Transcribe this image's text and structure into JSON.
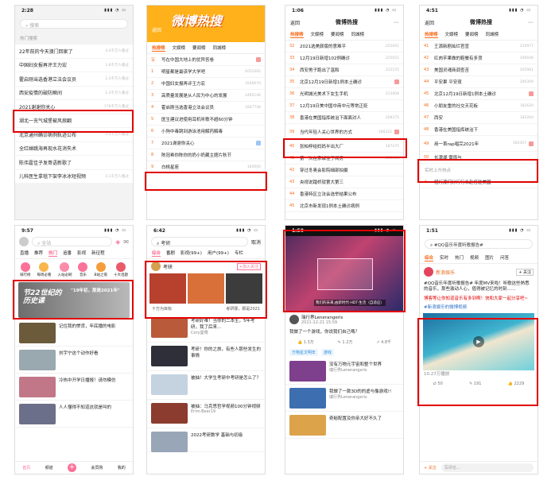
{
  "p1": {
    "time": "2:28",
    "search_placeholder": "搜索",
    "section": "热门搜索",
    "items": [
      {
        "text": "22年前的今天澳门回家了",
        "heat": "4.4千万人看过"
      },
      {
        "text": "中国妇女报再评王力宏",
        "heat": "3.6千万人看过"
      },
      {
        "text": "霍启刚当选香港立法会议员",
        "heat": "2.3千万人看过"
      },
      {
        "text": "西安疫情的破防瞬间",
        "heat": "1.3千万人看过"
      },
      {
        "text": "2021谢谢你关心",
        "heat": "178千万人看过"
      },
      {
        "text": "湖北一充气城堡被风掀翻",
        "heat": ""
      },
      {
        "text": "北京通州确诊病例轨迹公布",
        "heat": "3.2千万人看过"
      },
      {
        "text": "全红婵跳海再现水花消失术",
        "heat": ""
      },
      {
        "text": "陈伟霆佳子发哥语新歌了",
        "heat": ""
      },
      {
        "text": "儿科医生拿毯下架李冰冰短视频",
        "heat": "3.1千万人看过"
      }
    ]
  },
  "p2": {
    "time": "12:07",
    "title": "微博热搜",
    "back": "返回",
    "tabs": [
      "热搜榜",
      "文娱榜",
      "要闻榜",
      "同城榜"
    ],
    "items": [
      {
        "rank": "写",
        "text": "写在中国大地上的优异答卷"
      },
      {
        "rank": "1",
        "text": "明星都是最该学大学吧",
        "heat": "4052092"
      },
      {
        "rank": "2",
        "text": "中国妇女报再评王力宏",
        "heat": "3546670"
      },
      {
        "rank": "3",
        "text": "高质量发展是从人民为中心的发展",
        "heat": "2490146"
      },
      {
        "rank": "4",
        "text": "霍启刚当选香港立法会议员",
        "heat": "1847748"
      },
      {
        "rank": "5",
        "text": "医生建议进使用耳机听歌不超60分钟",
        "heat": ""
      },
      {
        "rank": "6",
        "text": "小狗中毒跳到游泳池用解药解毒",
        "heat": ""
      },
      {
        "rank": "7",
        "text": "2021谢谢你关心",
        "heat": ""
      },
      {
        "rank": "8",
        "text": "陈冠希你陈你的奶小奶藏主题片秋节",
        "heat": ""
      },
      {
        "rank": "9",
        "text": "白桃星座",
        "heat": "160000"
      }
    ]
  },
  "p3": {
    "time": "1:06",
    "title": "微博热搜",
    "back": "返回",
    "tabs": [
      "热搜榜",
      "文娱榜",
      "要闻榜",
      "同城榜"
    ],
    "items": [
      {
        "rank": "32",
        "text": "2021选美颜版的意难平",
        "heat": "225691"
      },
      {
        "rank": "33",
        "text": "12月19日新增102例确诊",
        "heat": "225651"
      },
      {
        "rank": "34",
        "text": "西安男子跑出了温和",
        "heat": "215155"
      },
      {
        "rank": "35",
        "text": "北京12月19日新增1例本土确诊",
        "heat": ""
      },
      {
        "rank": "36",
        "text": "光明城光美术下女生手机",
        "heat": "213008"
      },
      {
        "rank": "37",
        "text": "12月19日美中国中商中元等常正贬",
        "heat": ""
      },
      {
        "rank": "38",
        "text": "香港在美国指挥统治下面面对人",
        "heat": "208375"
      },
      {
        "rank": "39",
        "text": "当代年轻人关心世界的方式",
        "heat": "188322"
      },
      {
        "rank": "40",
        "text": "张柏梓给妈妈半出大厂",
        "heat": "187475"
      },
      {
        "rank": "41",
        "text": "第一次在京城住了间房",
        "heat": "185906"
      },
      {
        "rank": "42",
        "text": "穿过冬奥会影院细部拍摄",
        "heat": ""
      },
      {
        "rank": "43",
        "text": "央视说踏桥就第大第三",
        "heat": ""
      },
      {
        "rank": "44",
        "text": "香港特区立法会选举结果公布",
        "heat": ""
      },
      {
        "rank": "45",
        "text": "北京市新发现1例本土确诊病例",
        "heat": ""
      }
    ]
  },
  "p4": {
    "time": "4:51",
    "title": "微博热搜",
    "back": "返回",
    "tabs": [
      "热搜榜",
      "文娱榜",
      "要闻榜",
      "同城榜"
    ],
    "items": [
      {
        "rank": "41",
        "text": "王源新剧灿烂官宣",
        "heat": "210977"
      },
      {
        "rank": "42",
        "text": "红肉芋果做的鞋餐有多顶",
        "heat": "206646"
      },
      {
        "rank": "43",
        "text": "美国灵魂商调查苦",
        "heat": "205961"
      },
      {
        "rank": "44",
        "text": "平安果 平安夜",
        "heat": "200309"
      },
      {
        "rank": "45",
        "text": "北京12月19日新增1例本土确诊",
        "heat": ""
      },
      {
        "rank": "46",
        "text": "小朋友重的社交天花板",
        "heat": "182620"
      },
      {
        "rank": "47",
        "text": "西安",
        "heat": "182204"
      },
      {
        "rank": "48",
        "text": "香港在美国指挥统治下",
        "heat": ""
      },
      {
        "rank": "49",
        "text": "用一首rap唱完2021年",
        "heat": "160307"
      },
      {
        "rank": "50",
        "text": "长津湖 雷雨与",
        "heat": ""
      }
    ],
    "section": "实时上升热点",
    "extra": "招行澳门分行行长赴任驻美国"
  },
  "p5": {
    "time": "9:57",
    "search": "全站",
    "tabs": [
      "直播",
      "推荐",
      "热门",
      "追番",
      "影视",
      "新征程"
    ],
    "icons": [
      "排行榜",
      "每周必看",
      "入站必刷",
      "音乐",
      "B站之夜",
      "十大话题"
    ],
    "banner_title": "\"19年初，那是2021年\"",
    "banner_big": "节22世纪的历史课",
    "feed": [
      "记住我的惨货，年底播的电影",
      "刘宇宁这个动作好看",
      "冷热中开学日播报！请勿模仿",
      "人人懂得不知道这就是叫的",
      "冰冰求原梦"
    ],
    "bottom": [
      "首页",
      "频道",
      "",
      "会员购",
      "我的"
    ]
  },
  "p6": {
    "time": "6:42",
    "search": "考研",
    "cancel": "取消",
    "tabs": [
      "综合",
      "番剧",
      "影视(99+)",
      "用户(99+)",
      "专栏"
    ],
    "user": "考研",
    "follow": "+加入关注",
    "label1": "十万为目标",
    "label2": "考研罪，那是2021",
    "posts": [
      {
        "text": "考研好难！当你的二本生，5年考研，我了后来…",
        "meta": "Cory曼慢"
      },
      {
        "text": "考研！你的之旅，有些人那些发生的事情",
        "meta": ""
      },
      {
        "text": "被抽！大学生考研中考研是怎么了？",
        "meta": ""
      },
      {
        "text": "被抽：马克思哲学视频100分钟视频",
        "meta": "Erim-Bear19"
      },
      {
        "text": "2022考研数学 基础与初级"
      }
    ]
  },
  "p7": {
    "time": "1:50",
    "caption": "我们的未来,由新时代-HDT-生活（自适应）",
    "author": "瑞行界Lenerangeris",
    "post_meta": "2021-12-21 15:59",
    "post_text": "我做了一个游戏，你说我们自己嗎？",
    "likes": "1.3万",
    "comments": "1.2万",
    "shares": "4.8千",
    "tags": [
      "万物星文明年",
      "游戏"
    ],
    "feed": [
      {
        "title": "没有万物元宇宙和整个世界",
        "author": "瑞行界Lenerangeris"
      },
      {
        "title": "我做了一款3D的的虚与像游戏!!",
        "author": "瑞行界Lenerangeris"
      },
      {
        "title": "奇秘配置及你亲大好不久了",
        "author": ""
      }
    ]
  },
  "p8": {
    "time": "1:51",
    "search": "#QQ音乐年度听歌报告#",
    "tabs": [
      "综合",
      "实时",
      "热门",
      "视频",
      "图片",
      "问答"
    ],
    "user": "新浪娱乐",
    "post": "#QQ音乐年度听歌报告# 年度MV来啦！听歌这些熟悉的音乐，那些激动人心，值得被记忆的时刻……",
    "highlight": "博客等让你知道音乐有多到啊！快和大家一起分享吧~",
    "link": "#新浪娱乐的微博视频",
    "video_meta": "10.27万播放",
    "counts": [
      "50",
      "191",
      "2229"
    ],
    "input": "写评论...",
    "followbtn": "+ 关注"
  }
}
